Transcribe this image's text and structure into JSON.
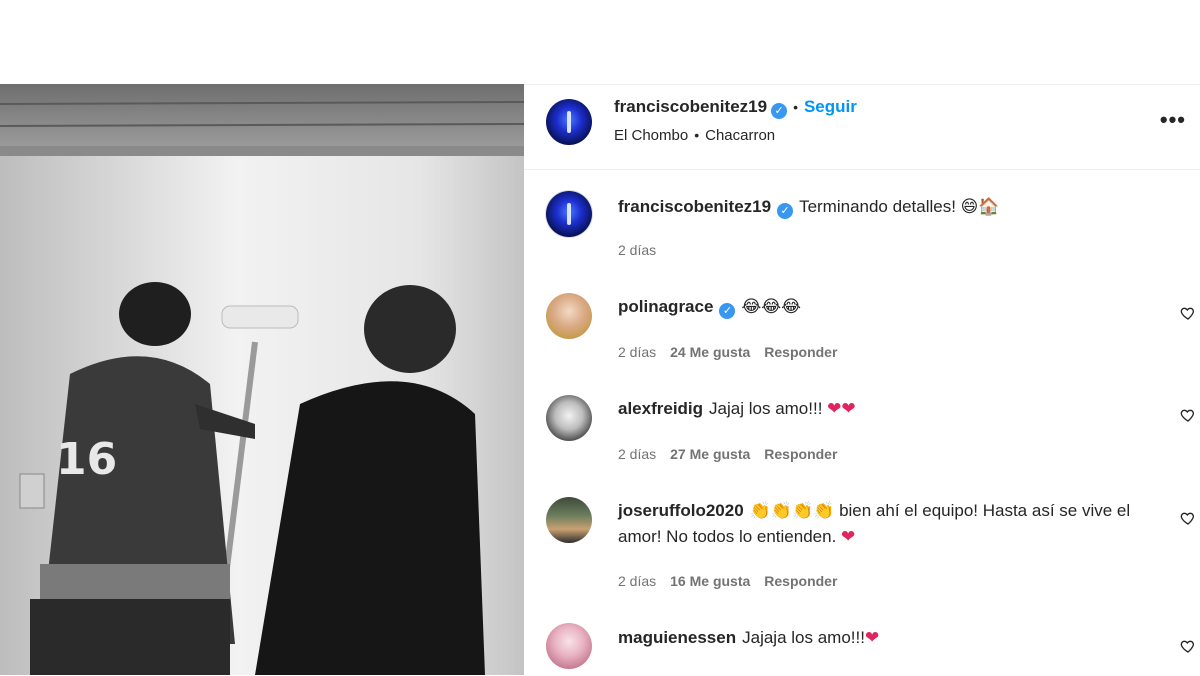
{
  "post": {
    "author": "franciscobenitez19",
    "follow_label": "Seguir",
    "separator": "•",
    "audio_artist": "El Chombo",
    "audio_track": "Chacarron",
    "more_label": "•••",
    "caption_text": "Terminando detalles!",
    "caption_emoji": "😄🏠",
    "caption_time": "2 días"
  },
  "comments": [
    {
      "user": "polinagrace",
      "verified": true,
      "text": "",
      "emoji": "😂😂😂",
      "time": "2 días",
      "likes": "24 Me gusta",
      "reply": "Responder"
    },
    {
      "user": "alexfreidig",
      "verified": false,
      "text": "Jajaj los amo!!!",
      "emoji": "❤❤",
      "time": "2 días",
      "likes": "27 Me gusta",
      "reply": "Responder"
    },
    {
      "user": "joseruffolo2020",
      "verified": false,
      "claps": "👏👏👏👏",
      "text": "bien ahí el equipo! Hasta así se vive el amor! No todos lo entienden.",
      "emoji": "❤",
      "time": "2 días",
      "likes": "16 Me gusta",
      "reply": "Responder"
    },
    {
      "user": "maguienessen",
      "verified": false,
      "text": "Jajaja los amo!!!",
      "emoji": "❤",
      "time": "",
      "likes": "",
      "reply": ""
    }
  ],
  "colors": {
    "accent": "#0095f6",
    "verified": "#3897f0",
    "heart_red": "#e0245e"
  },
  "icons": [
    "verified-badge-icon",
    "more-options-icon",
    "like-heart-icon"
  ]
}
